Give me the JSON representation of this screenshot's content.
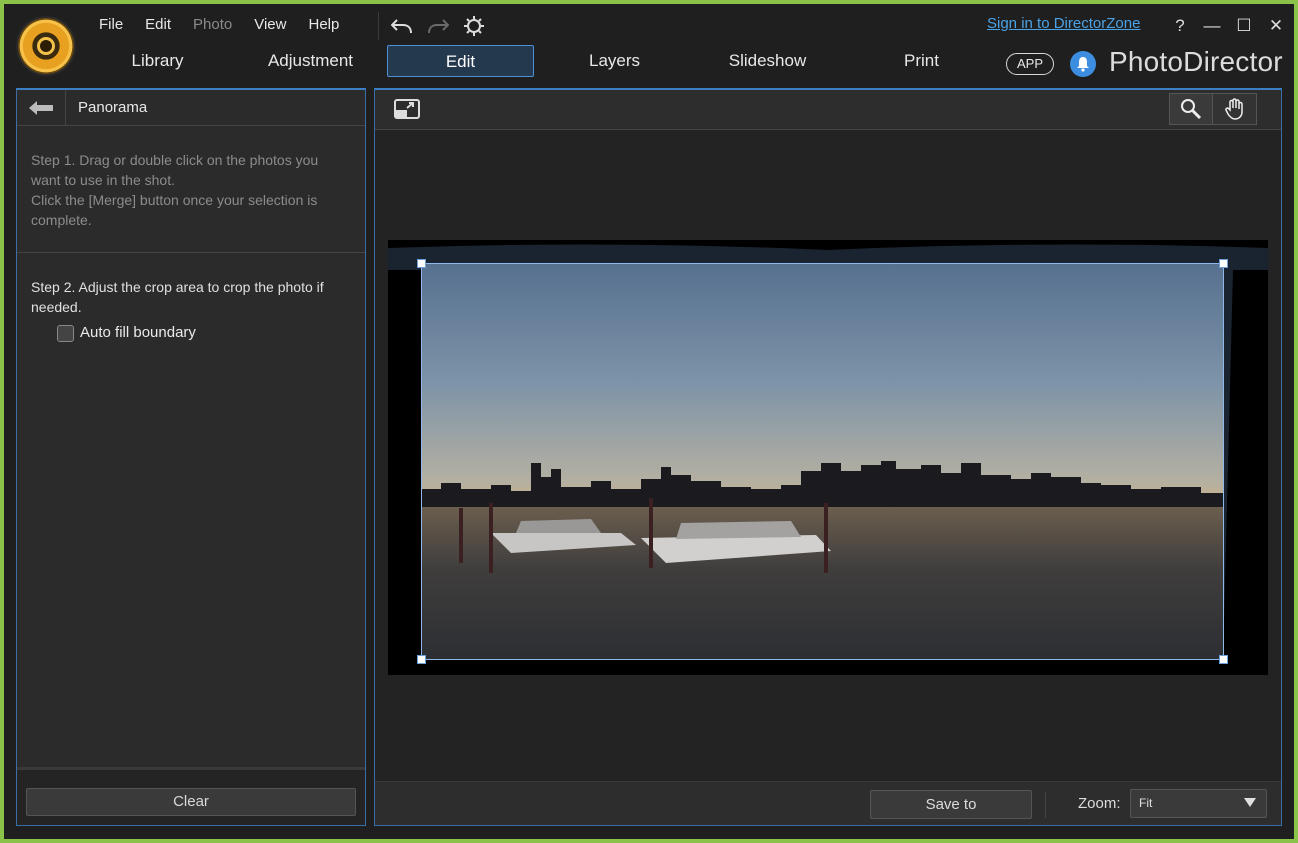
{
  "app": {
    "brand": "PhotoDirector",
    "app_badge": "APP",
    "sign_in": "Sign in to DirectorZone"
  },
  "menu": [
    "File",
    "Edit",
    "Photo",
    "View",
    "Help"
  ],
  "window_buttons": {
    "help": "?",
    "minimize": "—",
    "maximize": "☐",
    "close": "✕"
  },
  "modes": [
    "Library",
    "Adjustment",
    "Edit",
    "Layers",
    "Slideshow",
    "Print"
  ],
  "active_mode": "Edit",
  "left_panel": {
    "title": "Panorama",
    "step1": "Step 1. Drag or double click on the photos you want to use in the shot.\nClick the [Merge] button once your selection is complete.",
    "step1_line1": "Step 1. Drag or double click on the photos you want to use in the shot.",
    "step1_line2": "Click the [Merge] button once your selection is complete.",
    "step2": "Step 2. Adjust the crop area to crop the photo if needed.",
    "auto_fill_label": "Auto fill boundary",
    "auto_fill_checked": false,
    "clear_label": "Clear"
  },
  "bottom_bar": {
    "save_to_label": "Save to",
    "zoom_label": "Zoom:",
    "zoom_value": "Fit"
  },
  "colors": {
    "accent": "#3b7fc4",
    "active_tab_bg": "#24384e",
    "link": "#4aa3e8",
    "outer_border": "#8bc34a"
  },
  "icons": {
    "logo": "photodirector-aperture-icon",
    "back": "back-arrow-icon",
    "undo": "undo-icon",
    "redo": "redo-icon",
    "settings": "gear-icon",
    "bell": "bell-icon",
    "fit": "fit-to-window-icon",
    "zoom": "magnifier-icon",
    "pan": "hand-icon"
  }
}
